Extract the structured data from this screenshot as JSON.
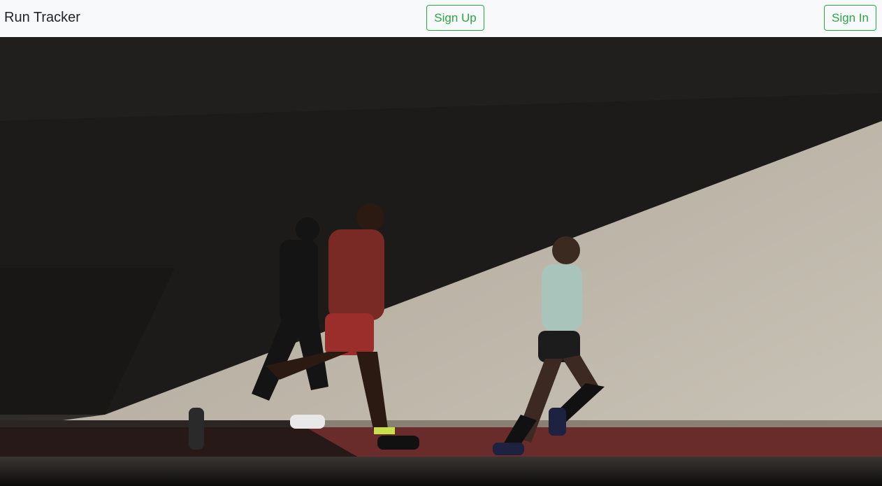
{
  "navbar": {
    "brand": "Run Tracker",
    "sign_up_label": "Sign Up",
    "sign_in_label": "Sign In",
    "accent_color": "#28a745"
  },
  "hero": {
    "image": "hero-photo"
  }
}
